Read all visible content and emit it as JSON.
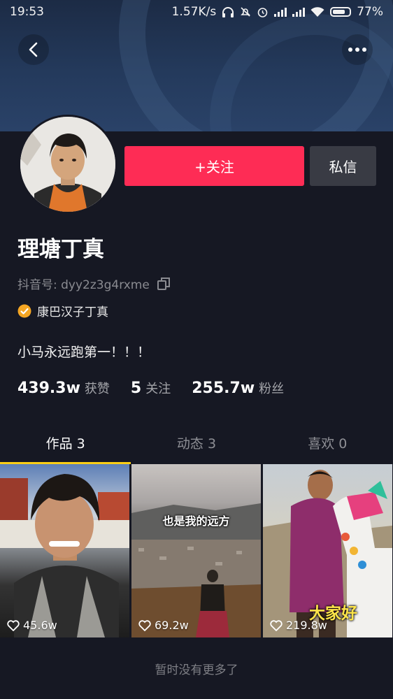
{
  "status_bar": {
    "time": "19:53",
    "network_speed": "1.57K/s",
    "battery": "77%",
    "battery_level": 0.77,
    "icons": [
      "headphones-icon",
      "mute-bell-icon",
      "alarm-icon",
      "signal-icon",
      "signal-icon",
      "wifi-icon",
      "battery-icon"
    ]
  },
  "header": {
    "back_icon": "back-arrow-icon",
    "more_icon": "more-dots-icon"
  },
  "profile": {
    "follow_label": "+关注",
    "message_label": "私信",
    "name": "理塘丁真",
    "douyin_id": "抖音号: dyy2z3g4rxme",
    "verified_text": "康巴汉子丁真",
    "bio": "小马永远跑第一！！！",
    "stats": [
      {
        "num": "439.3w",
        "label": "获赞"
      },
      {
        "num": "5",
        "label": "关注"
      },
      {
        "num": "255.7w",
        "label": "粉丝"
      }
    ]
  },
  "tabs": [
    {
      "label": "作品 3",
      "active": true
    },
    {
      "label": "动态 3",
      "active": false
    },
    {
      "label": "喜欢 0",
      "active": false
    }
  ],
  "videos": [
    {
      "likes": "45.6w",
      "overlay": ""
    },
    {
      "likes": "69.2w",
      "overlay": "也是我的远方"
    },
    {
      "likes": "219.8w",
      "overlay": "大家好"
    }
  ],
  "footer": {
    "no_more": "暂时没有更多了"
  },
  "colors": {
    "background": "#161823",
    "follow": "#fe2c55",
    "tab_indicator": "#face15",
    "verified": "#f5a623"
  }
}
